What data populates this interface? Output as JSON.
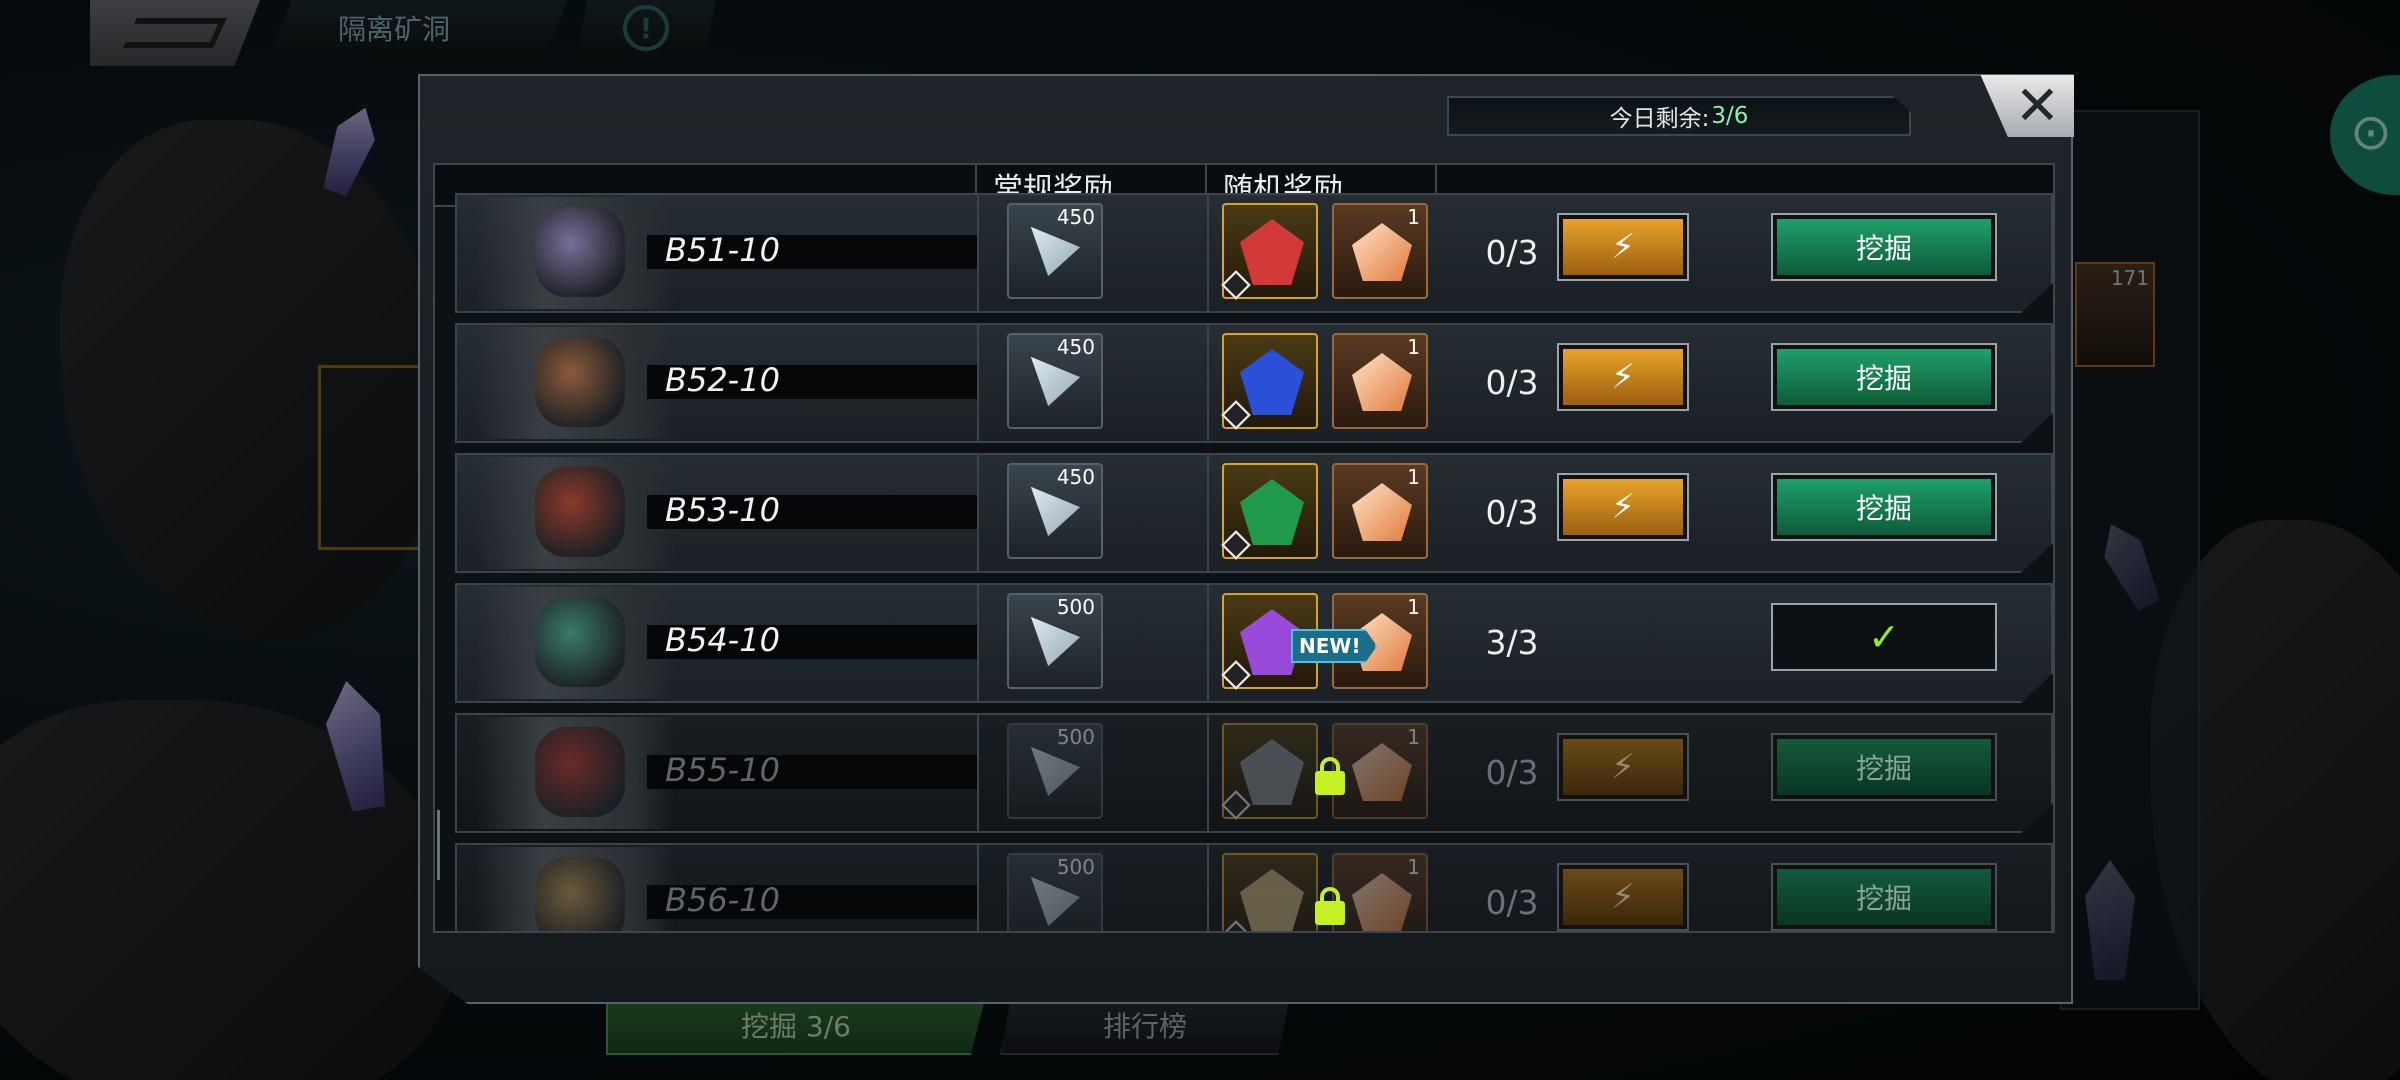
{
  "topbar": {
    "location": "隔离矿洞",
    "info_glyph": "!"
  },
  "background": {
    "card_count": "171",
    "dig_tab": "挖掘 3/6",
    "rank_tab": "排行榜"
  },
  "modal": {
    "close_glyph": "✕",
    "remaining_label": "今日剩余: ",
    "remaining_value": "3/6",
    "headers": {
      "normal_reward": "常规奖励",
      "random_reward": "随机奖励"
    },
    "rows": [
      {
        "name": "B51-10",
        "std_qty": "450",
        "shard_qty": "1",
        "count": "0/3",
        "energy": "⚡",
        "dig": "挖掘",
        "locked": false,
        "gem": "red-gem",
        "gem_color": "#d23a3a"
      },
      {
        "name": "B52-10",
        "std_qty": "450",
        "shard_qty": "1",
        "count": "0/3",
        "energy": "⚡",
        "dig": "挖掘",
        "locked": false,
        "gem": "blue-gem",
        "gem_color": "#2a4fd8"
      },
      {
        "name": "B53-10",
        "std_qty": "450",
        "shard_qty": "1",
        "count": "0/3",
        "energy": "⚡",
        "dig": "挖掘",
        "locked": false,
        "gem": "green-gem",
        "gem_color": "#1e9a4a"
      },
      {
        "name": "B54-10",
        "new": "NEW!",
        "std_qty": "500",
        "shard_qty": "1",
        "count": "3/3",
        "done": "✓",
        "locked": false,
        "gem": "purple-gem",
        "gem_color": "#9a4ad8"
      },
      {
        "name": "B55-10",
        "std_qty": "500",
        "shard_qty": "1",
        "count": "0/3",
        "energy": "⚡",
        "dig": "挖掘",
        "locked": true,
        "gem": "gray-gem",
        "gem_color": "#8a8f95"
      },
      {
        "name": "B56-10",
        "std_qty": "500",
        "shard_qty": "1",
        "count": "0/3",
        "energy": "⚡",
        "dig": "挖掘",
        "locked": true,
        "gem": "gold-gem",
        "gem_color": "#c9b37a"
      }
    ]
  }
}
